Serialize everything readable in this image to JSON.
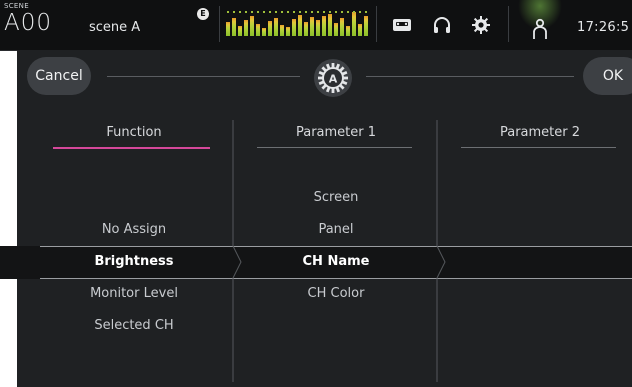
{
  "status_bar": {
    "scene_label": "SCENE",
    "scene_number": "A00",
    "scene_name": "scene A",
    "edit_badge": "E",
    "icons": [
      "recorder-icon",
      "headphones-icon",
      "gear-icon",
      "user-icon"
    ],
    "clock": "17:26:5"
  },
  "dialog": {
    "cancel_label": "Cancel",
    "ok_label": "OK",
    "knob_label": "A",
    "columns": [
      {
        "header": "Function",
        "items": [
          "No Assign",
          "Brightness",
          "Monitor Level",
          "Selected CH"
        ],
        "selected": "Brightness"
      },
      {
        "header": "Parameter 1",
        "items": [
          "Screen",
          "Panel",
          "CH Name",
          "CH Color"
        ],
        "selected": "CH Name"
      },
      {
        "header": "Parameter 2",
        "items": [],
        "selected": ""
      }
    ]
  },
  "colors": {
    "panel_bg": "#1f2123",
    "active_underline": "#d5489a",
    "meter_green": "#8dbf2a"
  }
}
